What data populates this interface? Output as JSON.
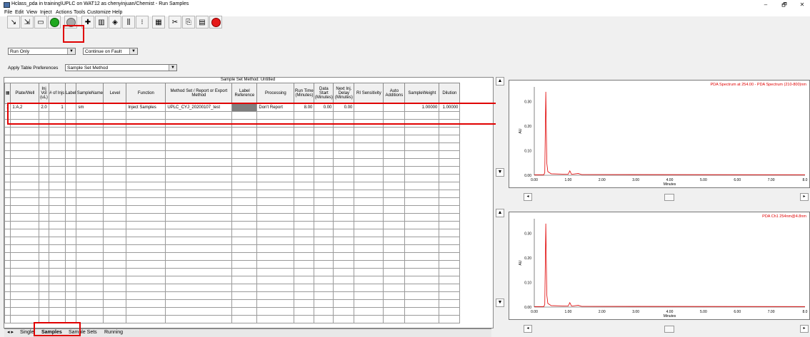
{
  "window": {
    "title": "Hclass_pda in training\\UPLC on WAT12 as chenyinjuan/Chemist - Run Samples",
    "min": "–",
    "max": "🗗",
    "close": "✕"
  },
  "menu": [
    "File",
    "Edit",
    "View",
    "Inject",
    "Actions",
    "Tools",
    "Customize",
    "Help"
  ],
  "toolbar_icons": [
    "load-method-icon",
    "load-samples-icon",
    "save-icon",
    "run-icon",
    "stop-icon",
    "add-icon",
    "column-icon",
    "wizard-icon",
    "dup-icon",
    "single-icon",
    "calc-icon",
    "cut-icon",
    "copy-icon",
    "paste-icon",
    "abort-icon"
  ],
  "selects": {
    "run_mode": "Run Only",
    "fault": "Continue on Fault",
    "preferences_label": "Apply Table Preferences",
    "preferences": "Sample Set Method"
  },
  "grid": {
    "title": "Sample Set Method: Untitled",
    "headers": [
      "Plate/Well",
      "Inj Vol (uL)",
      "# of Injs",
      "Label",
      "SampleName",
      "Level",
      "Function",
      "Method Set / Report or Export Method",
      "Label Reference",
      "Processing",
      "Run Time (Minutes)",
      "Data Start (Minutes)",
      "Next Inj. Delay (Minutes)",
      "RI Sensitivity",
      "Auto Additions",
      "SampleWeight",
      "Dilution"
    ],
    "row": {
      "num": "1",
      "plate": "1:A,2",
      "vol": "2.0",
      "injs": "1",
      "label": "",
      "name": "sm",
      "level": "",
      "function": "Inject Samples",
      "method": "UPLC_CYJ_20200107_test",
      "labelref": "",
      "processing": "Don't Report",
      "runtime": "8.00",
      "datastart": "0.00",
      "delay": "0.00",
      "ri": "",
      "auto": "",
      "weight": "1.00000",
      "dilution": "1.00000"
    }
  },
  "tabs": [
    "Single",
    "Samples",
    "Sample Sets",
    "Running"
  ],
  "plots": [
    {
      "title": "PDA Spectrum at 254.00 - PDA Spectrum (210-800)nm",
      "ylabel": "AU",
      "xlabel": "Minutes",
      "yticks": [
        "0.30",
        "0.20",
        "0.10",
        "0.00"
      ],
      "xticks": [
        "0.00",
        "1.00",
        "2.00",
        "3.00",
        "4.00",
        "5.00",
        "6.00",
        "7.00",
        "8.0"
      ]
    },
    {
      "title": "PDA Ch1 254nm@4.8nm",
      "ylabel": "AU",
      "xlabel": "Minutes",
      "yticks": [
        "0.30",
        "0.20",
        "0.10",
        "0.00"
      ],
      "xticks": [
        "0.00",
        "1.00",
        "2.00",
        "3.00",
        "4.00",
        "5.00",
        "6.00",
        "7.00",
        "8.0"
      ]
    }
  ],
  "colors": {
    "trace": "#e00000",
    "highlight": "#e00000"
  }
}
